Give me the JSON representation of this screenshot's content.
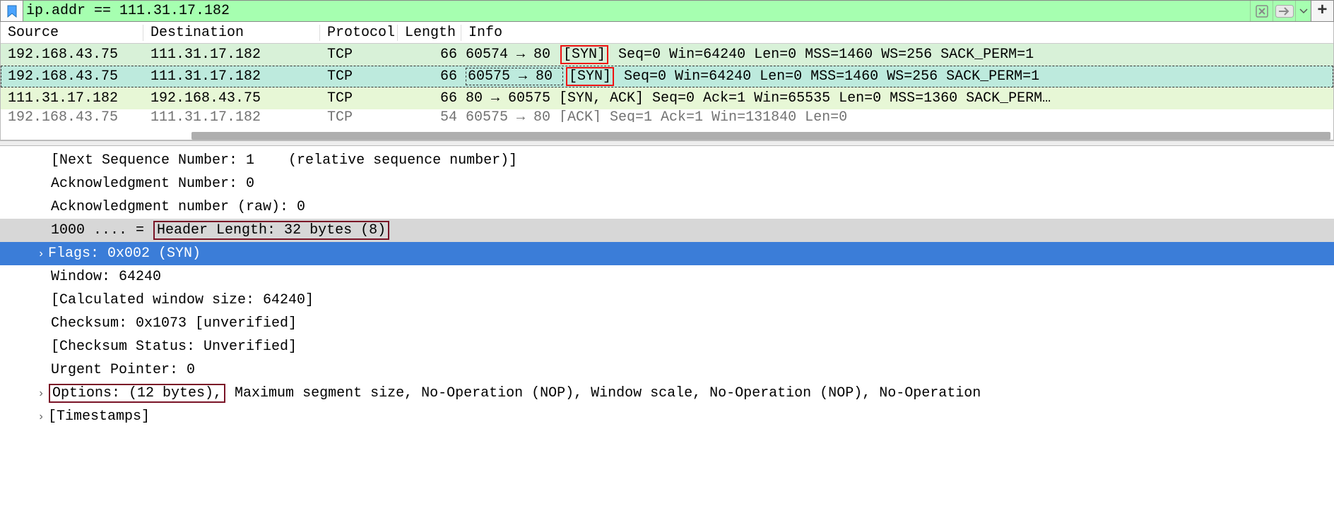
{
  "filter": {
    "expression": "ip.addr == 111.31.17.182"
  },
  "columns": {
    "source": "Source",
    "destination": "Destination",
    "protocol": "Protocol",
    "length": "Length",
    "info": "Info"
  },
  "packets": [
    {
      "source": "192.168.43.75",
      "destination": "111.31.17.182",
      "protocol": "TCP",
      "length": "66",
      "info_pre": "60574 → 80 ",
      "info_syn": "[SYN]",
      "info_post": " Seq=0 Win=64240 Len=0 MSS=1460 WS=256 SACK_PERM=1"
    },
    {
      "source": "192.168.43.75",
      "destination": "111.31.17.182",
      "protocol": "TCP",
      "length": "66",
      "info_pre": "60575 → 80 ",
      "info_syn": "[SYN]",
      "info_post": " Seq=0 Win=64240 Len=0 MSS=1460 WS=256 SACK_PERM=1"
    },
    {
      "source": "111.31.17.182",
      "destination": "192.168.43.75",
      "protocol": "TCP",
      "length": "66",
      "info_plain": "80 → 60575 [SYN, ACK] Seq=0 Ack=1 Win=65535 Len=0 MSS=1360 SACK_PERM…"
    },
    {
      "source": "192.168.43.75",
      "destination": "111.31.17.182",
      "protocol": "TCP",
      "length": "54",
      "info_plain": "60575 → 80 [ACK] Seq=1 Ack=1 Win=131840 Len=0"
    }
  ],
  "details": {
    "next_seq": "[Next Sequence Number: 1    (relative sequence number)]",
    "ack_num": "Acknowledgment Number: 0",
    "ack_raw": "Acknowledgment number (raw): 0",
    "header_len_prefix": "1000 .... = ",
    "header_len_box": "Header Length: 32 bytes (8)",
    "flags": "Flags: 0x002 (SYN)",
    "window": "Window: 64240",
    "calc_win": "[Calculated window size: 64240]",
    "checksum": "Checksum: 0x1073 [unverified]",
    "chk_status": "[Checksum Status: Unverified]",
    "urgent": "Urgent Pointer: 0",
    "options_box": "Options: (12 bytes),",
    "options_rest": " Maximum segment size, No-Operation (NOP), Window scale, No-Operation (NOP), No-Operation",
    "timestamps": "[Timestamps]"
  }
}
